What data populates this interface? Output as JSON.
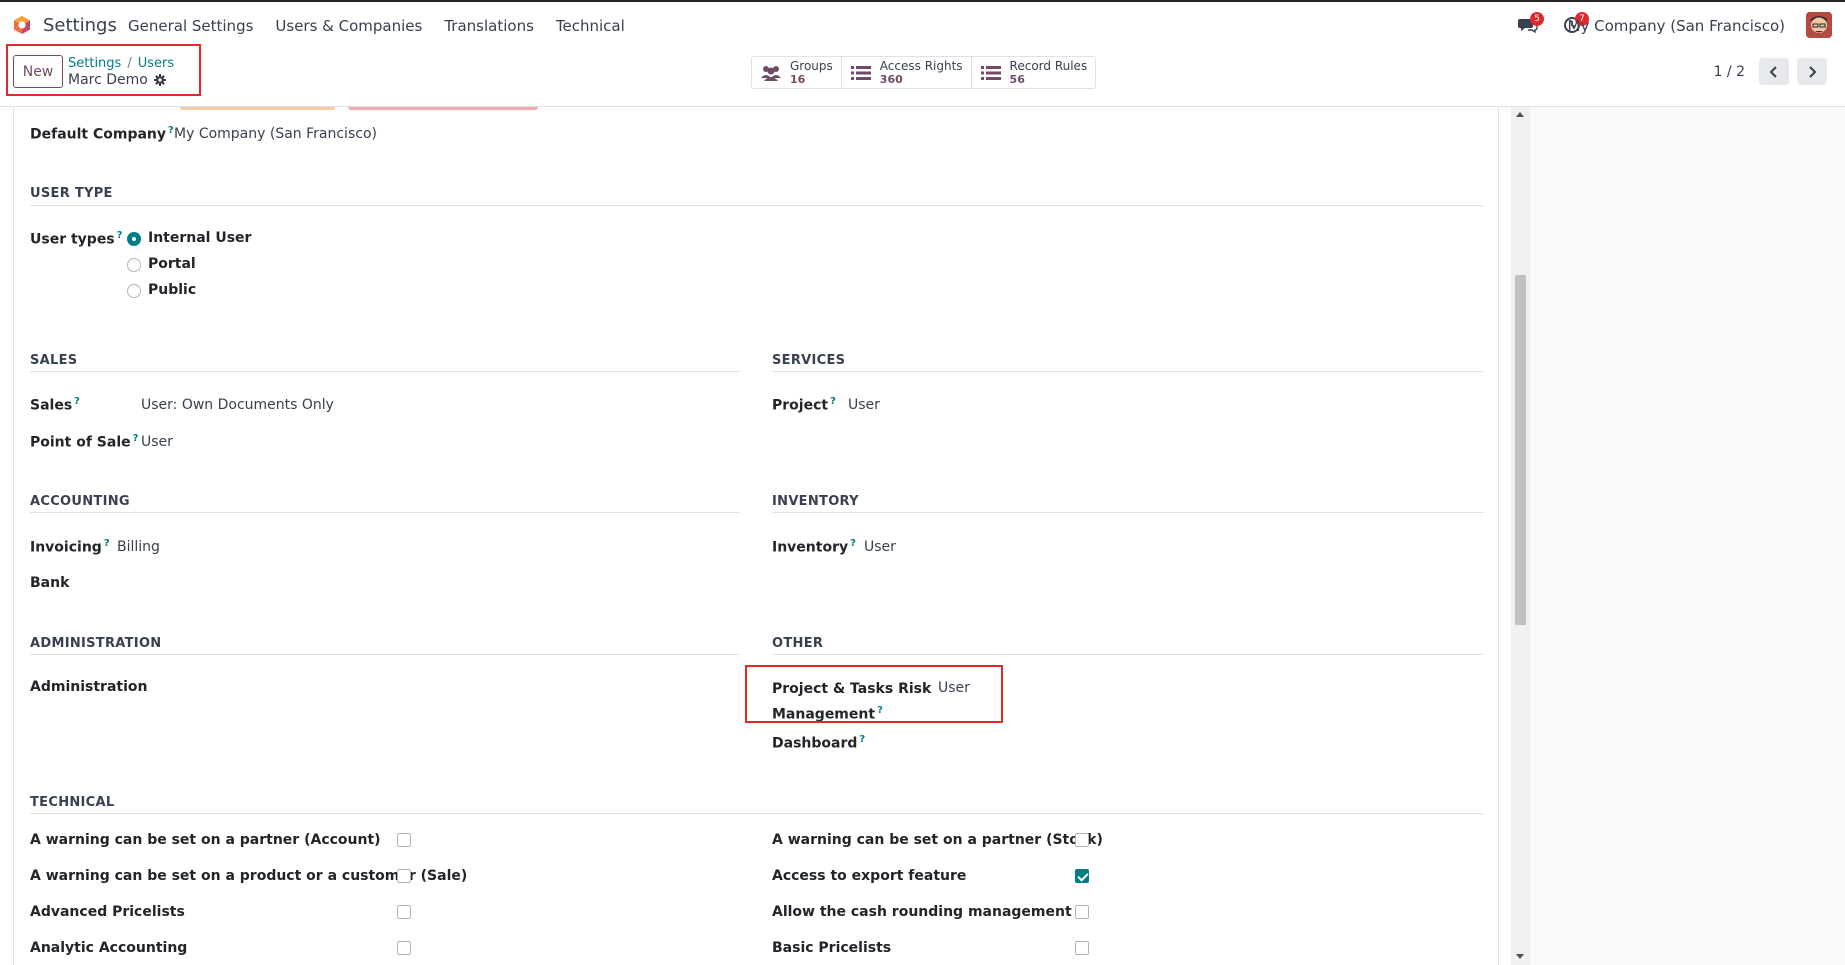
{
  "navbar": {
    "app_name": "Settings",
    "menu": [
      "General Settings",
      "Users & Companies",
      "Translations",
      "Technical"
    ],
    "messages_badge": "5",
    "activities_badge": "7",
    "company": "My Company (San Francisco)"
  },
  "control_panel": {
    "new_label": "New",
    "breadcrumb": [
      "Settings",
      "Users"
    ],
    "record_title": "Marc Demo",
    "smart_buttons": [
      {
        "label": "Groups",
        "count": "16",
        "icon": "users-icon"
      },
      {
        "label": "Access Rights",
        "count": "360",
        "icon": "list-icon"
      },
      {
        "label": "Record Rules",
        "count": "56",
        "icon": "list-icon"
      }
    ],
    "pager": "1 / 2"
  },
  "form": {
    "default_company": {
      "label": "Default Company",
      "value": "My Company (San Francisco)"
    },
    "user_type_section": "USER TYPE",
    "user_types": {
      "label": "User types",
      "options": [
        "Internal User",
        "Portal",
        "Public"
      ],
      "selected": "Internal User"
    },
    "sections": {
      "sales": "SALES",
      "services": "SERVICES",
      "accounting": "ACCOUNTING",
      "inventory": "INVENTORY",
      "administration": "ADMINISTRATION",
      "other": "OTHER",
      "technical": "TECHNICAL"
    },
    "fields": {
      "sales": {
        "label": "Sales",
        "value": "User: Own Documents Only"
      },
      "pos": {
        "label": "Point of Sale",
        "value": "User"
      },
      "project": {
        "label": "Project",
        "value": "User"
      },
      "invoicing": {
        "label": "Invoicing",
        "value": "Billing"
      },
      "bank": {
        "label": "Bank",
        "value": ""
      },
      "inventory": {
        "label": "Inventory",
        "value": "User"
      },
      "administration": {
        "label": "Administration",
        "value": ""
      },
      "risk_line1": "Project & Tasks Risk",
      "risk_line2": "Management",
      "risk_value": "User",
      "dashboard": {
        "label": "Dashboard",
        "value": ""
      }
    },
    "technical_left": [
      {
        "label": "A warning can be set on a partner (Account)",
        "checked": false
      },
      {
        "label": "A warning can be set on a product or a customer (Sale)",
        "checked": false
      },
      {
        "label": "Advanced Pricelists",
        "checked": false
      },
      {
        "label": "Analytic Accounting",
        "checked": false
      }
    ],
    "technical_right": [
      {
        "label": "A warning can be set on a partner (Stock)",
        "checked": false
      },
      {
        "label": "Access to export feature",
        "checked": true
      },
      {
        "label": "Allow the cash rounding management",
        "checked": false
      },
      {
        "label": "Basic Pricelists",
        "checked": false
      }
    ]
  },
  "colors": {
    "primary": "#714b67",
    "teal": "#017e84",
    "highlight": "#e3282c"
  }
}
